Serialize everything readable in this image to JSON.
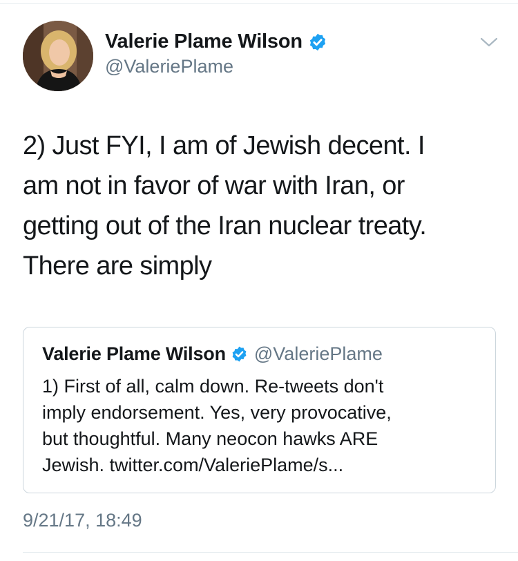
{
  "tweet": {
    "author_name": "Valerie Plame Wilson",
    "author_handle": "@ValeriePlame",
    "text": "2) Just FYI, I am of Jewish decent.  I\nam not in favor of war with Iran, or\ngetting out of the Iran nuclear treaty.\nThere are simply",
    "timestamp": "9/21/17, 18:49"
  },
  "quoted_tweet": {
    "author_name": "Valerie Plame Wilson",
    "author_handle": "@ValeriePlame",
    "text": "1) First of all, calm down.  Re-tweets don't\nimply endorsement.  Yes, very provocative,\nbut thoughtful. Many neocon hawks ARE\nJewish. twitter.com/ValeriePlame/s..."
  },
  "icons": {
    "verified": "verified-badge-icon",
    "menu": "chevron-down-icon"
  },
  "colors": {
    "verified_blue": "#1da1f2",
    "secondary_text": "#657786",
    "border": "#ccd6dd"
  }
}
